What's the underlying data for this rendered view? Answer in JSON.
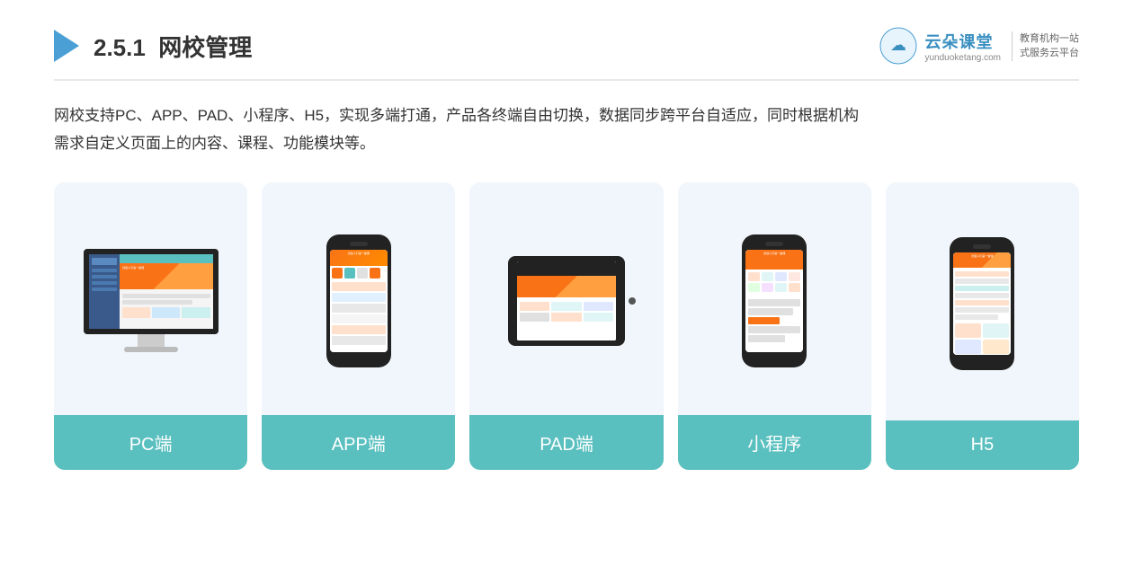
{
  "header": {
    "section_number": "2.5.1",
    "title_bold": "网校管理",
    "brand": {
      "name": "云朵课堂",
      "url": "yunduoketang.com",
      "slogan_line1": "教育机构一站",
      "slogan_line2": "式服务云平台"
    }
  },
  "description": {
    "text_line1": "网校支持PC、APP、PAD、小程序、H5，实现多端打通，产品各终端自由切换，数据同步跨平台自适应，同时根据机构",
    "text_line2": "需求自定义页面上的内容、课程、功能模块等。"
  },
  "cards": [
    {
      "id": "pc",
      "label": "PC端"
    },
    {
      "id": "app",
      "label": "APP端"
    },
    {
      "id": "pad",
      "label": "PAD端"
    },
    {
      "id": "miniapp",
      "label": "小程序"
    },
    {
      "id": "h5",
      "label": "H5"
    }
  ]
}
